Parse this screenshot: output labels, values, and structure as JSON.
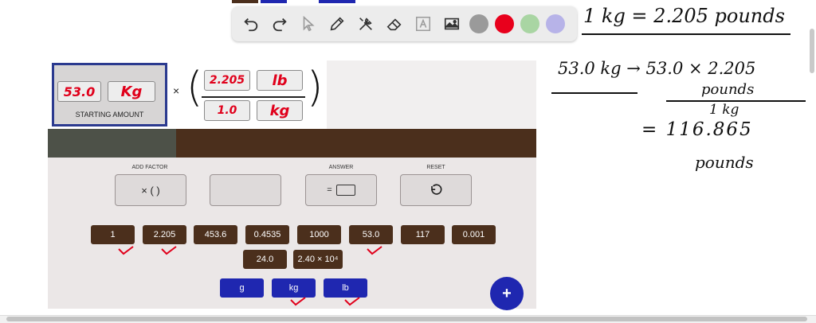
{
  "toolbar": {
    "tools": [
      "undo-icon",
      "redo-icon",
      "pointer-icon",
      "pen-icon",
      "tools-icon",
      "eraser-icon",
      "text-icon",
      "image-icon"
    ],
    "colors": [
      "#9a9a9a",
      "#e8001c",
      "#a9d5a3",
      "#b7b3e8"
    ]
  },
  "calculator": {
    "starting_amount": {
      "value": "53.0",
      "unit": "Kg",
      "label": "STARTING AMOUNT"
    },
    "times_sign": "×",
    "factor": {
      "num_value": "2.205",
      "num_unit": "lb",
      "den_value": "1.0",
      "den_unit": "kg"
    },
    "labels": {
      "add_factor": "ADD FACTOR",
      "answer": "ANSWER",
      "reset": "RESET"
    },
    "add_factor_button": "× (   )",
    "answer_button": "=",
    "reset_icon": "reset-icon",
    "tiles_row1": [
      "1",
      "2.205",
      "453.6",
      "0.4535",
      "1000",
      "53.0",
      "117",
      "0.001"
    ],
    "tiles_row2": [
      "24.0",
      "2.40 × 10⁴"
    ],
    "units": [
      "g",
      "kg",
      "lb"
    ],
    "fab": "+"
  },
  "handwriting": {
    "line1": "1 kg = 2.205 pounds",
    "line2": "53.0 kg → 53.0 × 2.205",
    "line2_num": "pounds",
    "line2_den": "1 kg",
    "line3": "= 116.865",
    "line4": "pounds"
  },
  "colors": {
    "brand_blue": "#1f27b0",
    "tile_brown": "#4b2f1c",
    "ink_red": "#e0001b"
  }
}
